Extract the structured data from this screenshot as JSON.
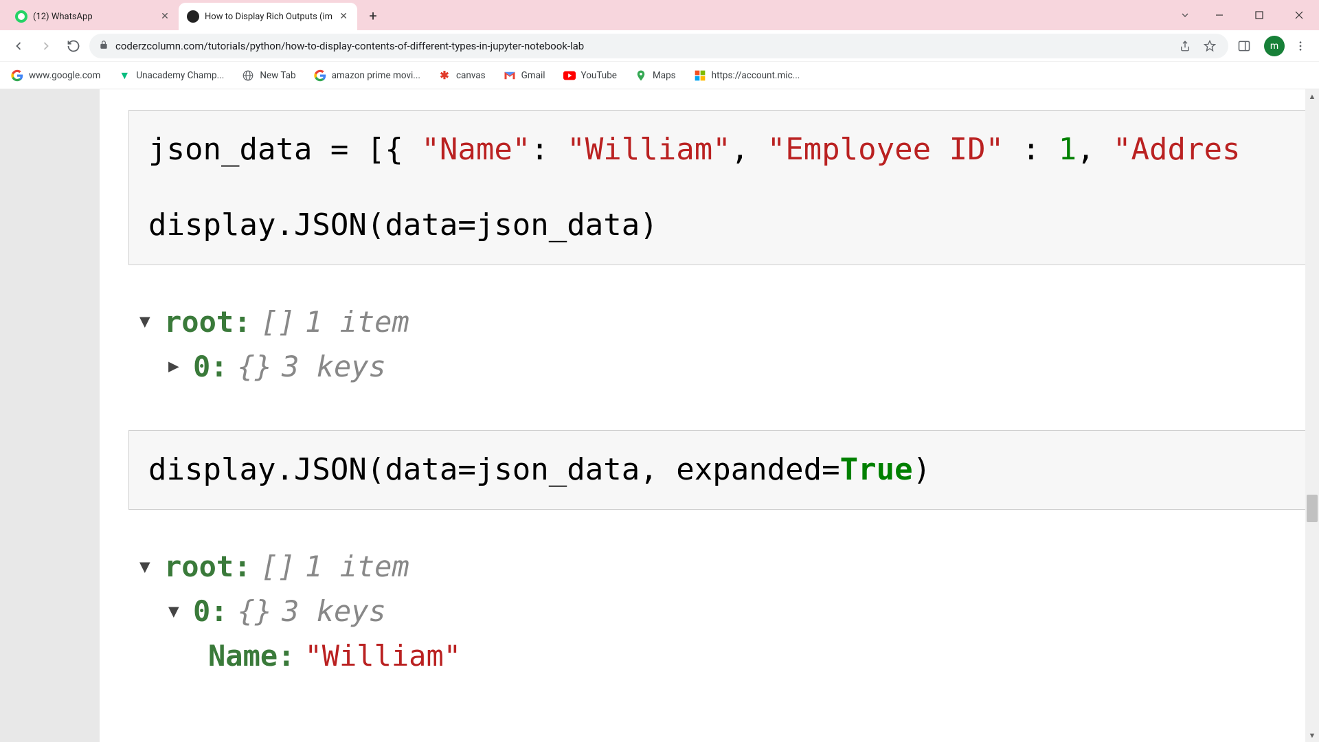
{
  "tabs": [
    {
      "favicon_bg": "#25d366",
      "favicon_txt": "●",
      "title": "(12) WhatsApp"
    },
    {
      "favicon_bg": "#222",
      "favicon_txt": "●",
      "title": "How to Display Rich Outputs (im"
    }
  ],
  "url": "coderzcolumn.com/tutorials/python/how-to-display-contents-of-different-types-in-jupyter-notebook-lab",
  "bookmarks": [
    {
      "icon_type": "google",
      "label": "www.google.com"
    },
    {
      "icon_type": "unacademy",
      "label": "Unacademy Champ..."
    },
    {
      "icon_type": "newtab",
      "label": "New Tab"
    },
    {
      "icon_type": "google",
      "label": "amazon prime movi..."
    },
    {
      "icon_type": "canvas",
      "label": "canvas"
    },
    {
      "icon_type": "gmail",
      "label": "Gmail"
    },
    {
      "icon_type": "youtube",
      "label": "YouTube"
    },
    {
      "icon_type": "maps",
      "label": "Maps"
    },
    {
      "icon_type": "microsoft",
      "label": "https://account.mic..."
    }
  ],
  "avatar_letter": "m",
  "code1": {
    "pre1": "json_data = [{ ",
    "k1": "\"Name\"",
    "sep1": ": ",
    "v1": "\"William\"",
    "sep2": ", ",
    "k2": "\"Employee ID\"",
    "sep3": " : ",
    "v2": "1",
    "sep4": ", ",
    "k3": "\"Addres",
    "line2": "display.JSON(data=json_data)"
  },
  "out1": {
    "root_label": "root:",
    "root_type": "[]",
    "root_meta": "1 item",
    "idx_label": "0:",
    "idx_type": "{}",
    "idx_meta": "3 keys"
  },
  "code2": {
    "pre": "display.JSON(data=json_data, expanded=",
    "bool": "True",
    "post": ")"
  },
  "out2": {
    "root_label": "root:",
    "root_type": "[]",
    "root_meta": "1 item",
    "idx_label": "0:",
    "idx_type": "{}",
    "idx_meta": "3 keys",
    "name_key": "Name:",
    "name_val": "\"William\""
  }
}
